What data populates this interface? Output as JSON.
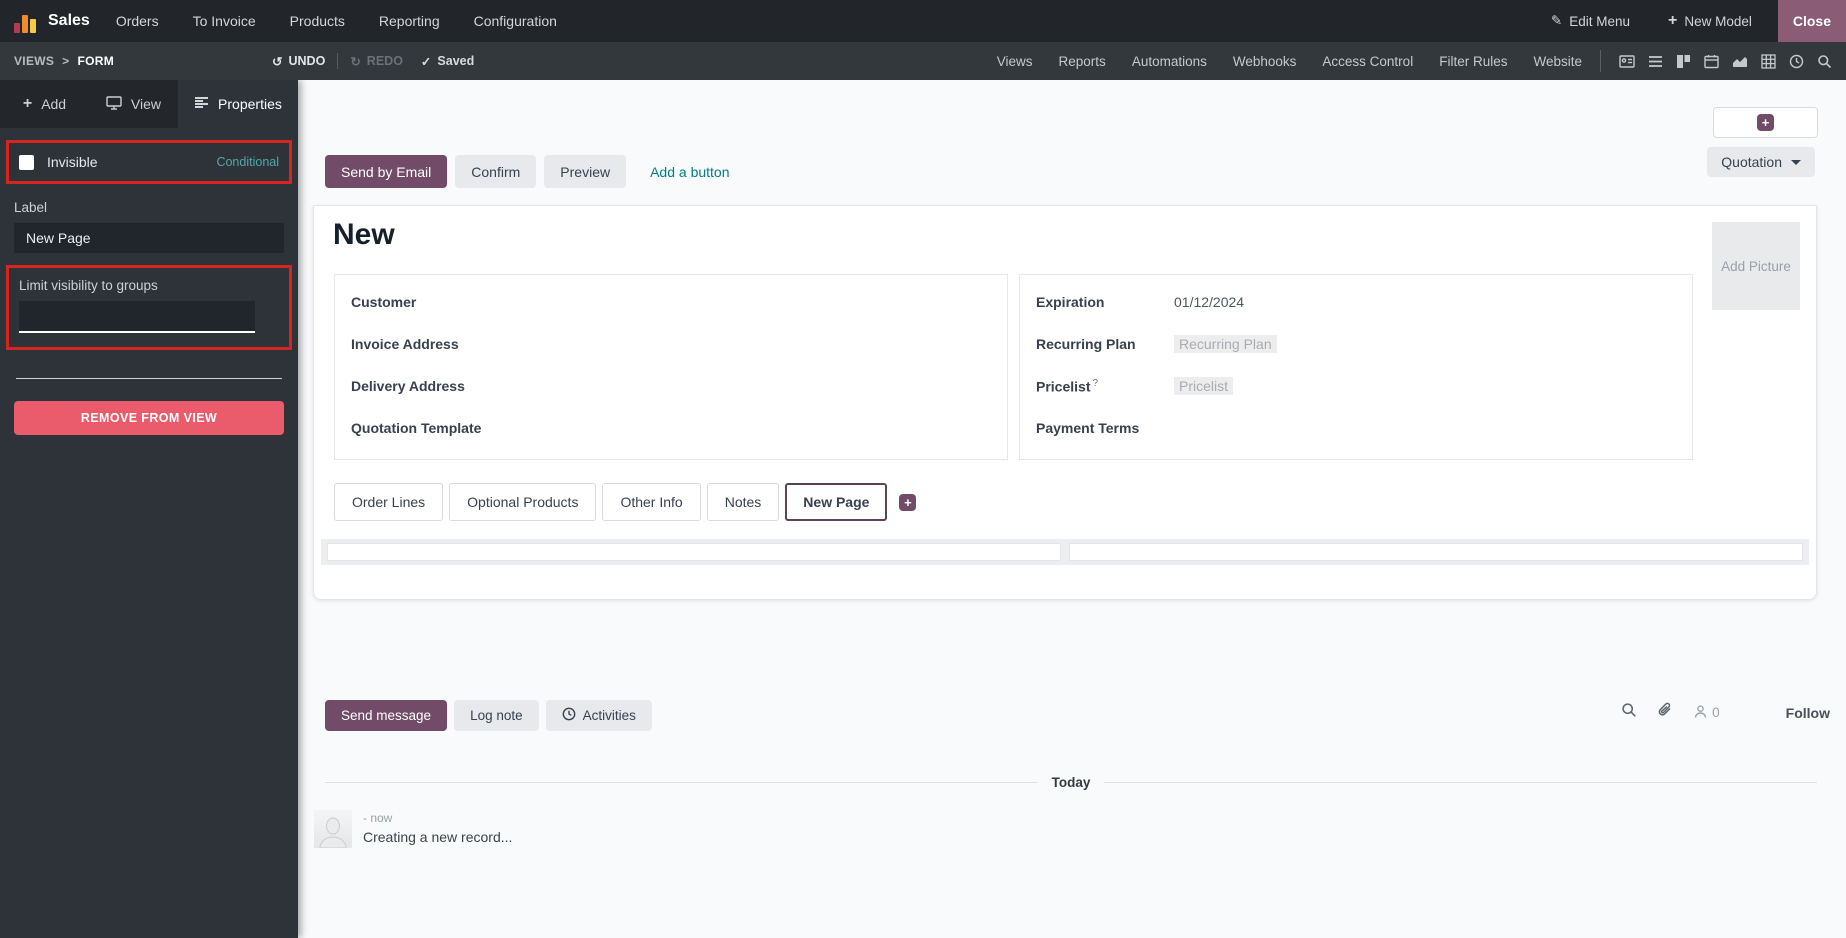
{
  "colors": {
    "primary_purple": "#714b67",
    "close_button": "#8a5c75",
    "annotation_red": "#d62420",
    "remove_button_red": "#ea5b6b",
    "conditional_teal": "#4fa8a8",
    "link_teal": "#017e84"
  },
  "topbar": {
    "app": "Sales",
    "menus": [
      "Orders",
      "To Invoice",
      "Products",
      "Reporting",
      "Configuration"
    ],
    "edit_menu": "Edit Menu",
    "new_model": "New Model",
    "close": "Close"
  },
  "studio": {
    "breadcrumb_root": "VIEWS",
    "breadcrumb_sep": ">",
    "breadcrumb_current": "FORM",
    "undo": "UNDO",
    "redo": "REDO",
    "saved": "Saved",
    "tabs": [
      "Views",
      "Reports",
      "Automations",
      "Webhooks",
      "Access Control",
      "Filter Rules",
      "Website"
    ],
    "view_icons": [
      "form-icon",
      "list-icon",
      "kanban-icon",
      "calendar-icon",
      "graph-icon",
      "pivot-icon",
      "activity-icon",
      "search-icon"
    ]
  },
  "sidebar": {
    "tab_add": "Add",
    "tab_view": "View",
    "tab_properties": "Properties",
    "invisible_label": "Invisible",
    "invisible_badge": "Conditional",
    "label_field_label": "Label",
    "label_field_value": "New Page",
    "groups_label": "Limit visibility to groups",
    "groups_value": "",
    "remove_button": "REMOVE FROM VIEW"
  },
  "form": {
    "send_by_email": "Send by Email",
    "confirm": "Confirm",
    "preview": "Preview",
    "add_a_button": "Add a button",
    "stage": "Quotation",
    "title": "New",
    "add_picture": "Add Picture",
    "fields_left": [
      "Customer",
      "Invoice Address",
      "Delivery Address",
      "Quotation Template"
    ],
    "fields_right": [
      {
        "label": "Expiration",
        "value": "01/12/2024"
      },
      {
        "label": "Recurring Plan",
        "placeholder": "Recurring Plan"
      },
      {
        "label": "Pricelist",
        "help": "?",
        "placeholder": "Pricelist"
      },
      {
        "label": "Payment Terms"
      }
    ],
    "tabs": [
      "Order Lines",
      "Optional Products",
      "Other Info",
      "Notes",
      "New Page"
    ],
    "active_tab": "New Page"
  },
  "chatter": {
    "send_message": "Send message",
    "log_note": "Log note",
    "activities": "Activities",
    "followers_count": "0",
    "follow": "Follow",
    "day": "Today",
    "message_time": "- now",
    "message_body": "Creating a new record..."
  }
}
